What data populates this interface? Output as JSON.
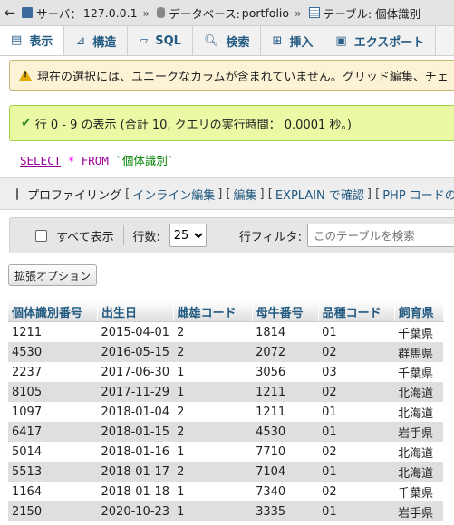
{
  "breadcrumb": {
    "server_label": "サーバ：",
    "server": "127.0.0.1",
    "database_label": "データベース:",
    "database": "portfolio",
    "table_label": "テーブル:",
    "table": "個体識別"
  },
  "tabs": [
    {
      "label": "表示",
      "icon": "table-icon"
    },
    {
      "label": "構造",
      "icon": "structure-icon"
    },
    {
      "label": "SQL",
      "icon": "sql-icon"
    },
    {
      "label": "検索",
      "icon": "search-icon"
    },
    {
      "label": "挿入",
      "icon": "insert-icon"
    },
    {
      "label": "エクスポート",
      "icon": "export-icon"
    }
  ],
  "notice": "現在の選択には、ユニークなカラムが含まれていません。グリッド編集、チェ",
  "success": "行 0 - 9 の表示 (合計 10, クエリの実行時間： 0.0001 秒。)",
  "sql": {
    "select": "SELECT",
    "star": "*",
    "from": "FROM",
    "table": "`個体識別`"
  },
  "profiling": {
    "label": "プロファイリング",
    "inline_edit": "インライン編集",
    "edit": "編集",
    "explain": "EXPLAIN で確認",
    "php": "PHP コードの"
  },
  "nav": {
    "show_all": "すべて表示",
    "rows_label": "行数:",
    "rows_value": "25",
    "filter_label": "行フィルタ:",
    "filter_placeholder": "このテーブルを検索"
  },
  "ext_options": "拡張オプション",
  "table": {
    "headers": [
      "個体識別番号",
      "出生日",
      "雌雄コード",
      "母牛番号",
      "品種コード",
      "飼育県"
    ],
    "rows": [
      [
        "1211",
        "2015-04-01",
        "2",
        "1814",
        "01",
        "千葉県"
      ],
      [
        "4530",
        "2016-05-15",
        "2",
        "2072",
        "02",
        "群馬県"
      ],
      [
        "2237",
        "2017-06-30",
        "1",
        "3056",
        "03",
        "千葉県"
      ],
      [
        "8105",
        "2017-11-29",
        "1",
        "1211",
        "02",
        "北海道"
      ],
      [
        "1097",
        "2018-01-04",
        "2",
        "1211",
        "01",
        "北海道"
      ],
      [
        "6417",
        "2018-01-15",
        "2",
        "4530",
        "01",
        "岩手県"
      ],
      [
        "5014",
        "2018-01-16",
        "1",
        "7710",
        "02",
        "北海道"
      ],
      [
        "5513",
        "2018-01-17",
        "2",
        "7104",
        "01",
        "北海道"
      ],
      [
        "1164",
        "2018-01-18",
        "1",
        "7340",
        "02",
        "千葉県"
      ],
      [
        "2150",
        "2020-10-23",
        "1",
        "3335",
        "01",
        "岩手県"
      ]
    ]
  }
}
